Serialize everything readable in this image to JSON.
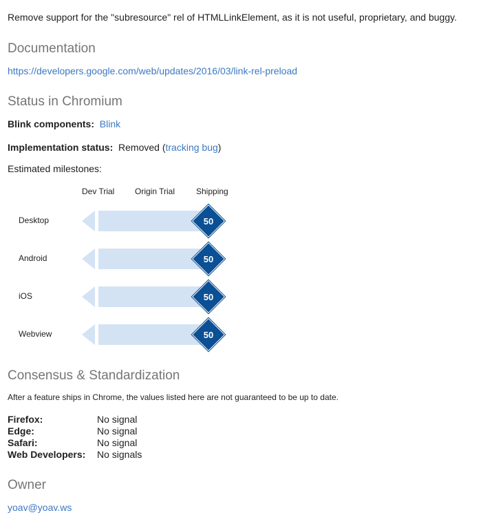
{
  "summary": "Remove support for the \"subresource\" rel of HTMLLinkElement, as it is not useful, proprietary, and buggy.",
  "documentation": {
    "heading": "Documentation",
    "link": "https://developers.google.com/web/updates/2016/03/link-rel-preload"
  },
  "status": {
    "heading": "Status in Chromium",
    "blink_label": "Blink components:",
    "blink_value": "Blink",
    "impl_label": "Implementation status:",
    "impl_value": "Removed (",
    "impl_link": "tracking bug",
    "impl_close": ")",
    "milestones_label": "Estimated milestones:",
    "columns": [
      "Dev Trial",
      "Origin Trial",
      "Shipping"
    ],
    "platforms": [
      {
        "name": "Desktop",
        "shipping": "50"
      },
      {
        "name": "Android",
        "shipping": "50"
      },
      {
        "name": "iOS",
        "shipping": "50"
      },
      {
        "name": "Webview",
        "shipping": "50"
      }
    ]
  },
  "consensus": {
    "heading": "Consensus & Standardization",
    "note": "After a feature ships in Chrome, the values listed here are not guaranteed to be up to date.",
    "browsers": [
      {
        "name": "Firefox:",
        "signal": "No signal"
      },
      {
        "name": "Edge:",
        "signal": "No signal"
      },
      {
        "name": "Safari:",
        "signal": "No signal"
      },
      {
        "name": "Web Developers:",
        "signal": "No signals"
      }
    ]
  },
  "owner": {
    "heading": "Owner",
    "email": "yoav@yoav.ws"
  },
  "colors": {
    "link": "#3b78c3",
    "heading": "#757575",
    "bar": "#d3e3f4",
    "diamond": "#0b4f94"
  }
}
